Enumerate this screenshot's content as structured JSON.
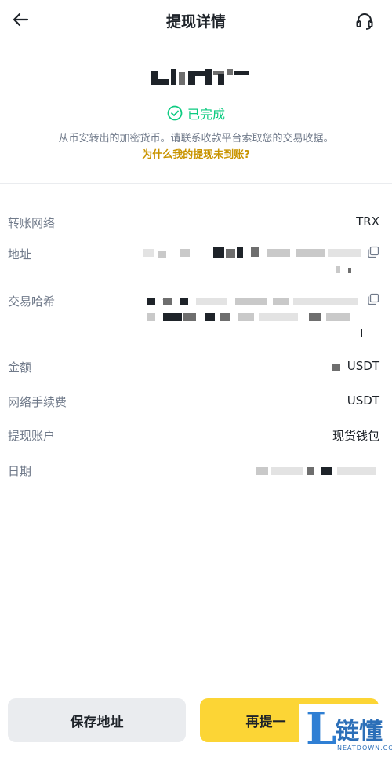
{
  "header": {
    "title": "提现详情",
    "back_icon": "arrow-left-icon",
    "support_icon": "headset-icon"
  },
  "amount": {
    "text": "USDT"
  },
  "status": {
    "text": "已完成",
    "color": "#0ecb81"
  },
  "info": {
    "text": "从币安转出的加密货币。请联系收款平台索取您的交易收据。",
    "link": "为什么我的提现未到账?"
  },
  "details": {
    "network": {
      "label": "转账网络",
      "value": "TRX"
    },
    "address": {
      "label": "地址"
    },
    "txid": {
      "label": "交易哈希"
    },
    "amount": {
      "label": "金额",
      "value": "USDT"
    },
    "fee": {
      "label": "网络手续费",
      "value": "USDT"
    },
    "account": {
      "label": "提现账户",
      "value": "现货钱包"
    },
    "date": {
      "label": "日期"
    }
  },
  "buttons": {
    "save": "保存地址",
    "retry": "再提一"
  },
  "watermark": {
    "main": "链懂",
    "sub": "NEATDOWN.COM"
  },
  "colors": {
    "accent": "#fcd535",
    "link": "#c99400",
    "success": "#0ecb81"
  }
}
